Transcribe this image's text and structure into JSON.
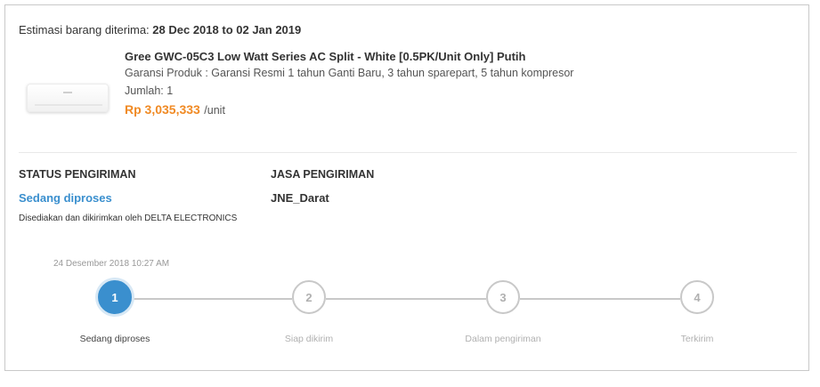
{
  "estimate": {
    "label": "Estimasi barang diterima:",
    "dates": "28 Dec 2018 to 02 Jan 2019"
  },
  "product": {
    "name": "Gree GWC-05C3 Low Watt Series AC Split - White [0.5PK/Unit Only] Putih",
    "warranty": "Garansi Produk : Garansi Resmi 1 tahun Ganti Baru, 3 tahun sparepart, 5 tahun kompresor",
    "quantity": "Jumlah: 1",
    "price": "Rp 3,035,333",
    "price_unit": "/unit",
    "image_icon": "air-conditioner-image"
  },
  "shipping_status": {
    "title": "STATUS PENGIRIMAN",
    "value": "Sedang diproses",
    "seller_note": "Disediakan dan dikirimkan oleh DELTA ELECTRONICS"
  },
  "courier": {
    "title": "JASA PENGIRIMAN",
    "value": "JNE_Darat"
  },
  "tracker": {
    "timestamp": "24 Desember 2018 10:27 AM",
    "active_step": 1,
    "steps": [
      {
        "number": "1",
        "label": "Sedang diproses"
      },
      {
        "number": "2",
        "label": "Siap dikirim"
      },
      {
        "number": "3",
        "label": "Dalam pengiriman"
      },
      {
        "number": "4",
        "label": "Terkirim"
      }
    ]
  },
  "colors": {
    "accent": "#3a8fce",
    "price": "#f08a24",
    "inactive": "#c8c8c8"
  }
}
